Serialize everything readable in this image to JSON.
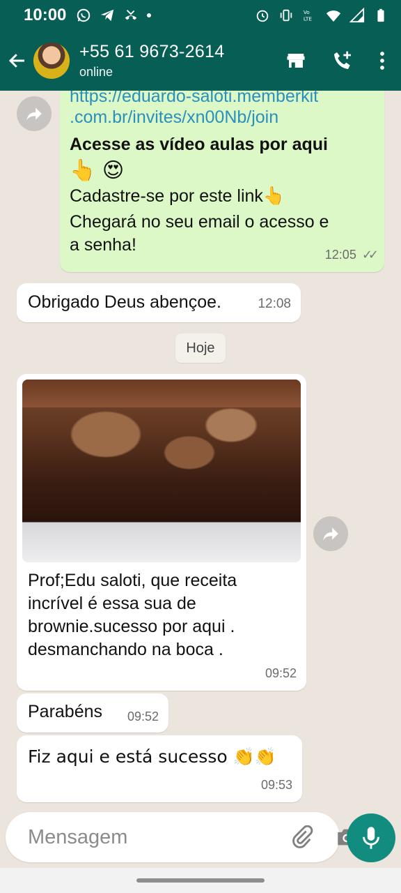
{
  "status_bar": {
    "time": "10:00",
    "icons_left": [
      "whatsapp-icon",
      "telegram-icon",
      "missed-call-icon",
      "dot-icon"
    ],
    "icons_right": [
      "alarm-icon",
      "vibrate-icon",
      "volte-icon",
      "wifi-icon",
      "signal-icon",
      "battery-icon"
    ]
  },
  "header": {
    "contact_name": "+55 61 9673-2614",
    "contact_status": "online",
    "icons": [
      "back-arrow-icon",
      "store-icon",
      "add-call-icon",
      "more-vert-icon"
    ]
  },
  "messages": [
    {
      "direction": "outgoing",
      "link_line1": "https://eduardo-saloti.memberkit",
      "link_line2": ".com.br/invites/xn00Nb/join",
      "bold_line": "Acesse as vídeo aulas por aqui",
      "emoji_line": "👆 😍",
      "line3": "Cadastre-se por este link👆",
      "line4": "Chegará no seu email o acesso e",
      "line5": "a senha!",
      "time": "12:05",
      "ticks": "✓✓"
    },
    {
      "direction": "incoming",
      "text": "Obrigado Deus abençoe.",
      "time": "12:08"
    },
    {
      "direction": "incoming",
      "has_photo": true,
      "line1": "Prof;Edu saloti, que receita",
      "line2": "incrível é essa sua de",
      "line3": "brownie.sucesso por aqui .",
      "line4": "desmanchando na boca .",
      "time": "09:52"
    },
    {
      "direction": "incoming",
      "text": "Parabéns",
      "time": "09:52"
    },
    {
      "direction": "incoming",
      "text": "Fiz aqui e está sucesso 👏👏",
      "time": "09:53"
    }
  ],
  "date_chip": "Hoje",
  "composer": {
    "placeholder": "Mensagem",
    "icons": [
      "emoji-icon",
      "attach-icon",
      "camera-icon",
      "mic-icon"
    ]
  },
  "colors": {
    "header": "#075e54",
    "outgoing_bubble": "#dcf8c6",
    "incoming_bubble": "#ffffff",
    "mic_button": "#128c7e",
    "link": "#2a8fbd"
  }
}
